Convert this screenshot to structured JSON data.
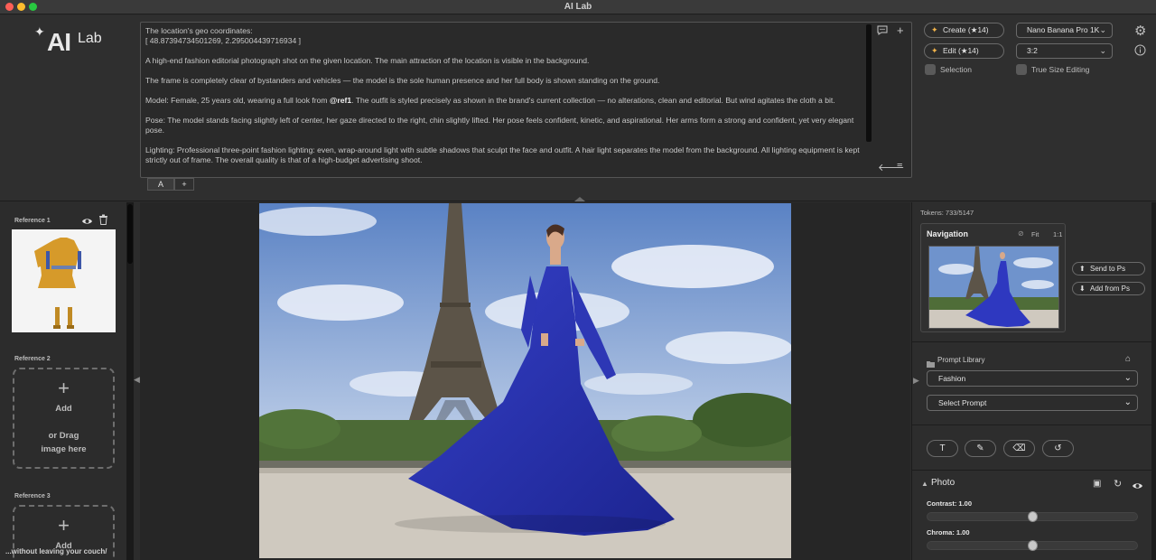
{
  "window": {
    "title": "AI Lab"
  },
  "logo": {
    "ai": "AI",
    "lab": "Lab",
    "spark": "✦"
  },
  "prompt": {
    "paragraphs": [
      "The location's geo coordinates:\n[ 48.87394734501269, 2.295004439716934 ]",
      "A high-end fashion editorial photograph shot on the given location. The main attraction of the location is visible in the background.",
      "The frame is completely clear of bystanders and vehicles — the model is the sole human presence and her full body is shown standing on the ground.",
      "Model: Female, 25 years old, wearing a full look from ",
      "Pose: The model stands facing slightly left of center, her gaze directed to the right, chin slightly lifted. Her pose feels confident, kinetic, and aspirational. Her arms form a strong and confident, yet very elegant pose.",
      "Lighting: Professional three-point fashion lighting: even, wrap-around light with subtle shadows that sculpt the face and outfit. A hair light separates the model from the background. All lighting equipment is kept strictly out of frame. The overall quality is that of a high-budget advertising shoot."
    ],
    "ref_tag": "@ref1",
    "model_after_ref": ". The outfit is styled precisely as shown in the brand's current collection — no alterations, clean and editorial. But wind agitates the cloth a bit.",
    "tabs": [
      "A",
      "+"
    ]
  },
  "controls": {
    "create_label": "Create (★14)",
    "edit_label": "Edit (★14)",
    "model_select": "Nano Banana Pro 1K",
    "ratio_select": "3:2",
    "selection_label": "Selection",
    "true_size_label": "True Size Editing"
  },
  "left": {
    "ref1_label": "Reference 1",
    "ref2_label": "Reference 2",
    "ref3_label": "Reference 3",
    "add_label": "Add",
    "drag_label": "or Drag\nimage here",
    "footer": "...without leaving your couch/"
  },
  "right": {
    "tokens": "Tokens: 733/5147",
    "navigation_title": "Navigation",
    "fit_label": "Fit",
    "one_to_one": "1:1",
    "send_to_ps": "Send to Ps",
    "add_from_ps": "Add from Ps",
    "prompt_library": "Prompt Library",
    "category_select": "Fashion",
    "prompt_select": "Select Prompt",
    "photo_title": "Photo",
    "sliders": [
      {
        "label": "Contrast: 1.00",
        "value": 0.5
      },
      {
        "label": "Chroma: 1.00",
        "value": 0.5
      }
    ]
  },
  "icons": {
    "chat": "chat-bubble-icon",
    "plus": "plus-icon",
    "back": "arrow-back-icon",
    "menu": "menu-icon",
    "gear": "gear-icon",
    "info": "info-icon",
    "eye": "eye-icon",
    "trash": "trash-icon",
    "home": "home-icon",
    "text_tool": "text-tool-icon",
    "brush": "brush-icon",
    "eraser": "eraser-icon",
    "undo": "undo-icon"
  },
  "colors": {
    "accent_star": "#f2b44a",
    "dress_blue": "#2a34b8"
  }
}
